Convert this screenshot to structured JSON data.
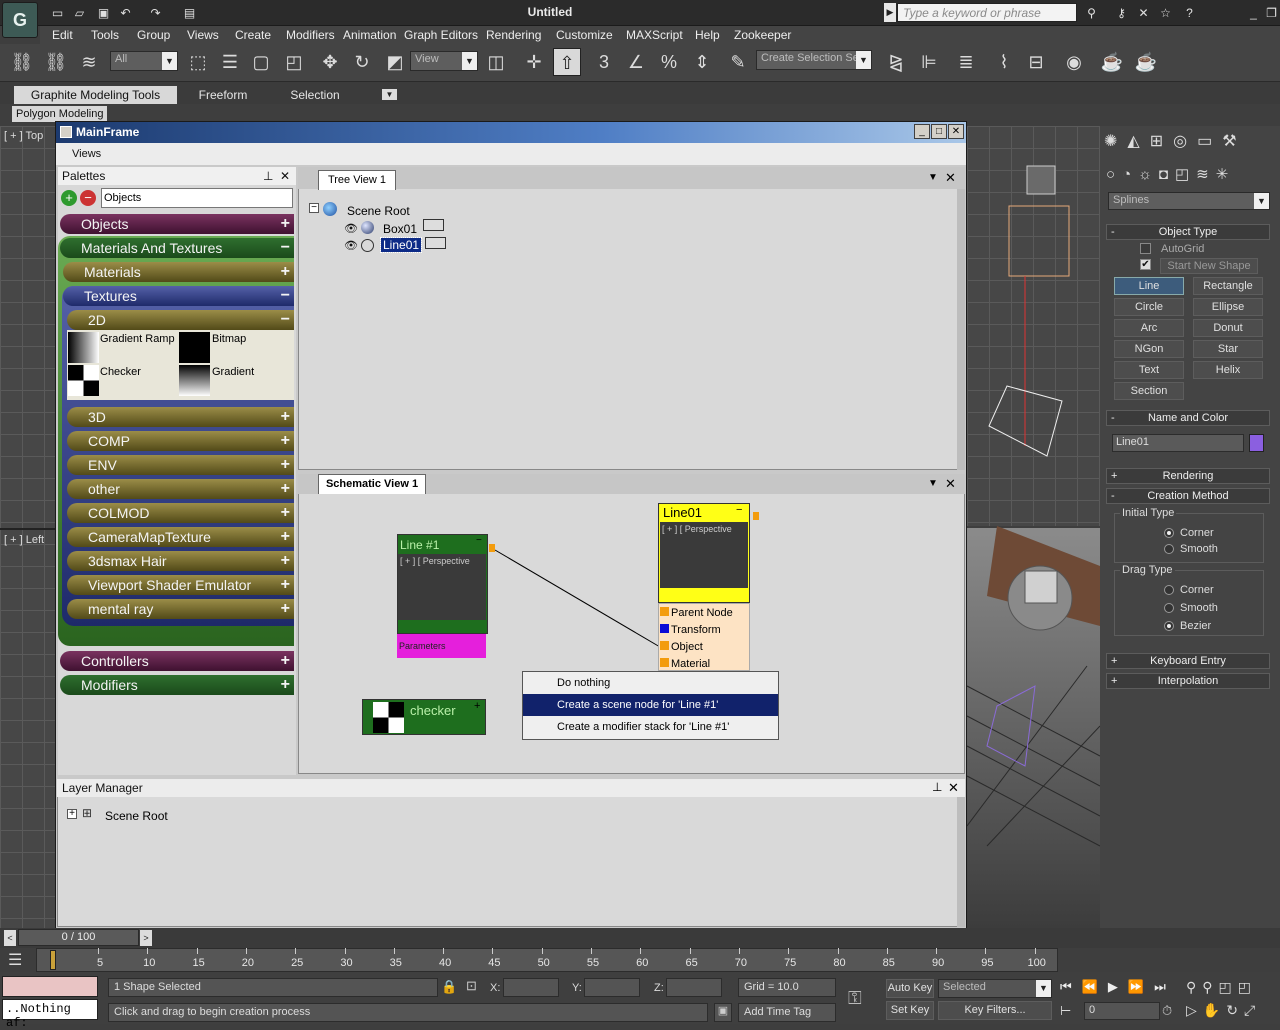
{
  "app": {
    "title": "Untitled",
    "logo_glyph": "G",
    "search_placeholder": "Type a keyword or phrase",
    "menu": [
      "Edit",
      "Tools",
      "Group",
      "Views",
      "Create",
      "Modifiers",
      "Animation",
      "Graph Editors",
      "Rendering",
      "Customize",
      "MAXScript",
      "Help",
      "Zookeeper"
    ]
  },
  "toolbar": {
    "filter_value": "All",
    "refcoord_value": "View",
    "selection_set_value": "Create Selection Se",
    "snap_label": "3"
  },
  "ribbon": {
    "tabs": [
      "Graphite Modeling Tools",
      "Freeform",
      "Selection"
    ],
    "sub_label": "Polygon Modeling"
  },
  "viewports": {
    "top_label": "[ + ] Top",
    "left_label": "[ + ] Left"
  },
  "mainframe": {
    "title": "MainFrame",
    "menu_label": "Views",
    "palettes_title": "Palettes",
    "palette_search": "Objects",
    "pill_plus": "+",
    "pill_minus": "−",
    "categories": {
      "objects": "Objects",
      "materials_textures": "Materials And Textures",
      "materials": "Materials",
      "textures": "Textures",
      "twod": "2D",
      "threed": "3D",
      "comp": "COMP",
      "env": "ENV",
      "other": "other",
      "colmod": "COLMOD",
      "cameramap": "CameraMapTexture",
      "hair": "3dsmax Hair",
      "shader_emulator": "Viewport Shader Emulator",
      "mental_ray": "mental ray",
      "controllers": "Controllers",
      "modifiers": "Modifiers"
    },
    "textures_2d": [
      "Gradient Ramp",
      "Bitmap",
      "Checker",
      "Gradient"
    ],
    "tree_tab": "Tree View 1",
    "tree": {
      "root": "Scene Root",
      "items": [
        "Box01",
        "Line01"
      ]
    },
    "schematic_tab": "Schematic View 1",
    "schematic": {
      "line_node_title": "Line #1",
      "line_node_params": "Parameters",
      "perspective_label": "[ + ] [ Perspective",
      "line01_title": "Line01",
      "line01_ports": [
        "Parent Node",
        "Transform",
        "Object",
        "Material"
      ],
      "checker_title": "checker"
    },
    "context_menu": [
      "Do nothing",
      "Create a scene node for 'Line #1'",
      "Create a modifier stack for 'Line #1'"
    ],
    "layer_manager_title": "Layer Manager",
    "layer_root": "Scene Root"
  },
  "command_panel": {
    "dropdown": "Splines",
    "object_type_title": "Object Type",
    "autogrid": "AutoGrid",
    "start_new_shape": "Start New Shape",
    "start_new_shape_checked": true,
    "shape_buttons": [
      "Line",
      "Rectangle",
      "Circle",
      "Ellipse",
      "Arc",
      "Donut",
      "NGon",
      "Star",
      "Text",
      "Helix",
      "Section"
    ],
    "name_color_title": "Name and Color",
    "object_name": "Line01",
    "object_color": "#8b5fe0",
    "rendering": "Rendering",
    "creation_method": "Creation Method",
    "initial_type": "Initial Type",
    "initial_options": [
      "Corner",
      "Smooth"
    ],
    "initial_selected": "Corner",
    "drag_type": "Drag Type",
    "drag_options": [
      "Corner",
      "Smooth",
      "Bezier"
    ],
    "drag_selected": "Bezier",
    "keyboard_entry": "Keyboard Entry",
    "interpolation": "Interpolation",
    "rollout_plus": "+",
    "rollout_minus": "-"
  },
  "timeline": {
    "frame_counter": "0 / 100",
    "ticks": [
      "5",
      "10",
      "15",
      "20",
      "25",
      "30",
      "35",
      "40",
      "45",
      "50",
      "55",
      "60",
      "65",
      "70",
      "75",
      "80",
      "85",
      "90",
      "95",
      "100"
    ]
  },
  "status": {
    "maxscript": "..Nothing af:",
    "selection_info": "1 Shape Selected",
    "prompt": "Click and drag to begin creation process",
    "x_label": "X:",
    "y_label": "Y:",
    "z_label": "Z:",
    "grid": "Grid = 10.0",
    "add_time_tag": "Add Time Tag",
    "auto_key": "Auto Key",
    "set_key": "Set Key",
    "selected_value": "Selected",
    "key_filters": "Key Filters...",
    "frame_value": "0"
  }
}
